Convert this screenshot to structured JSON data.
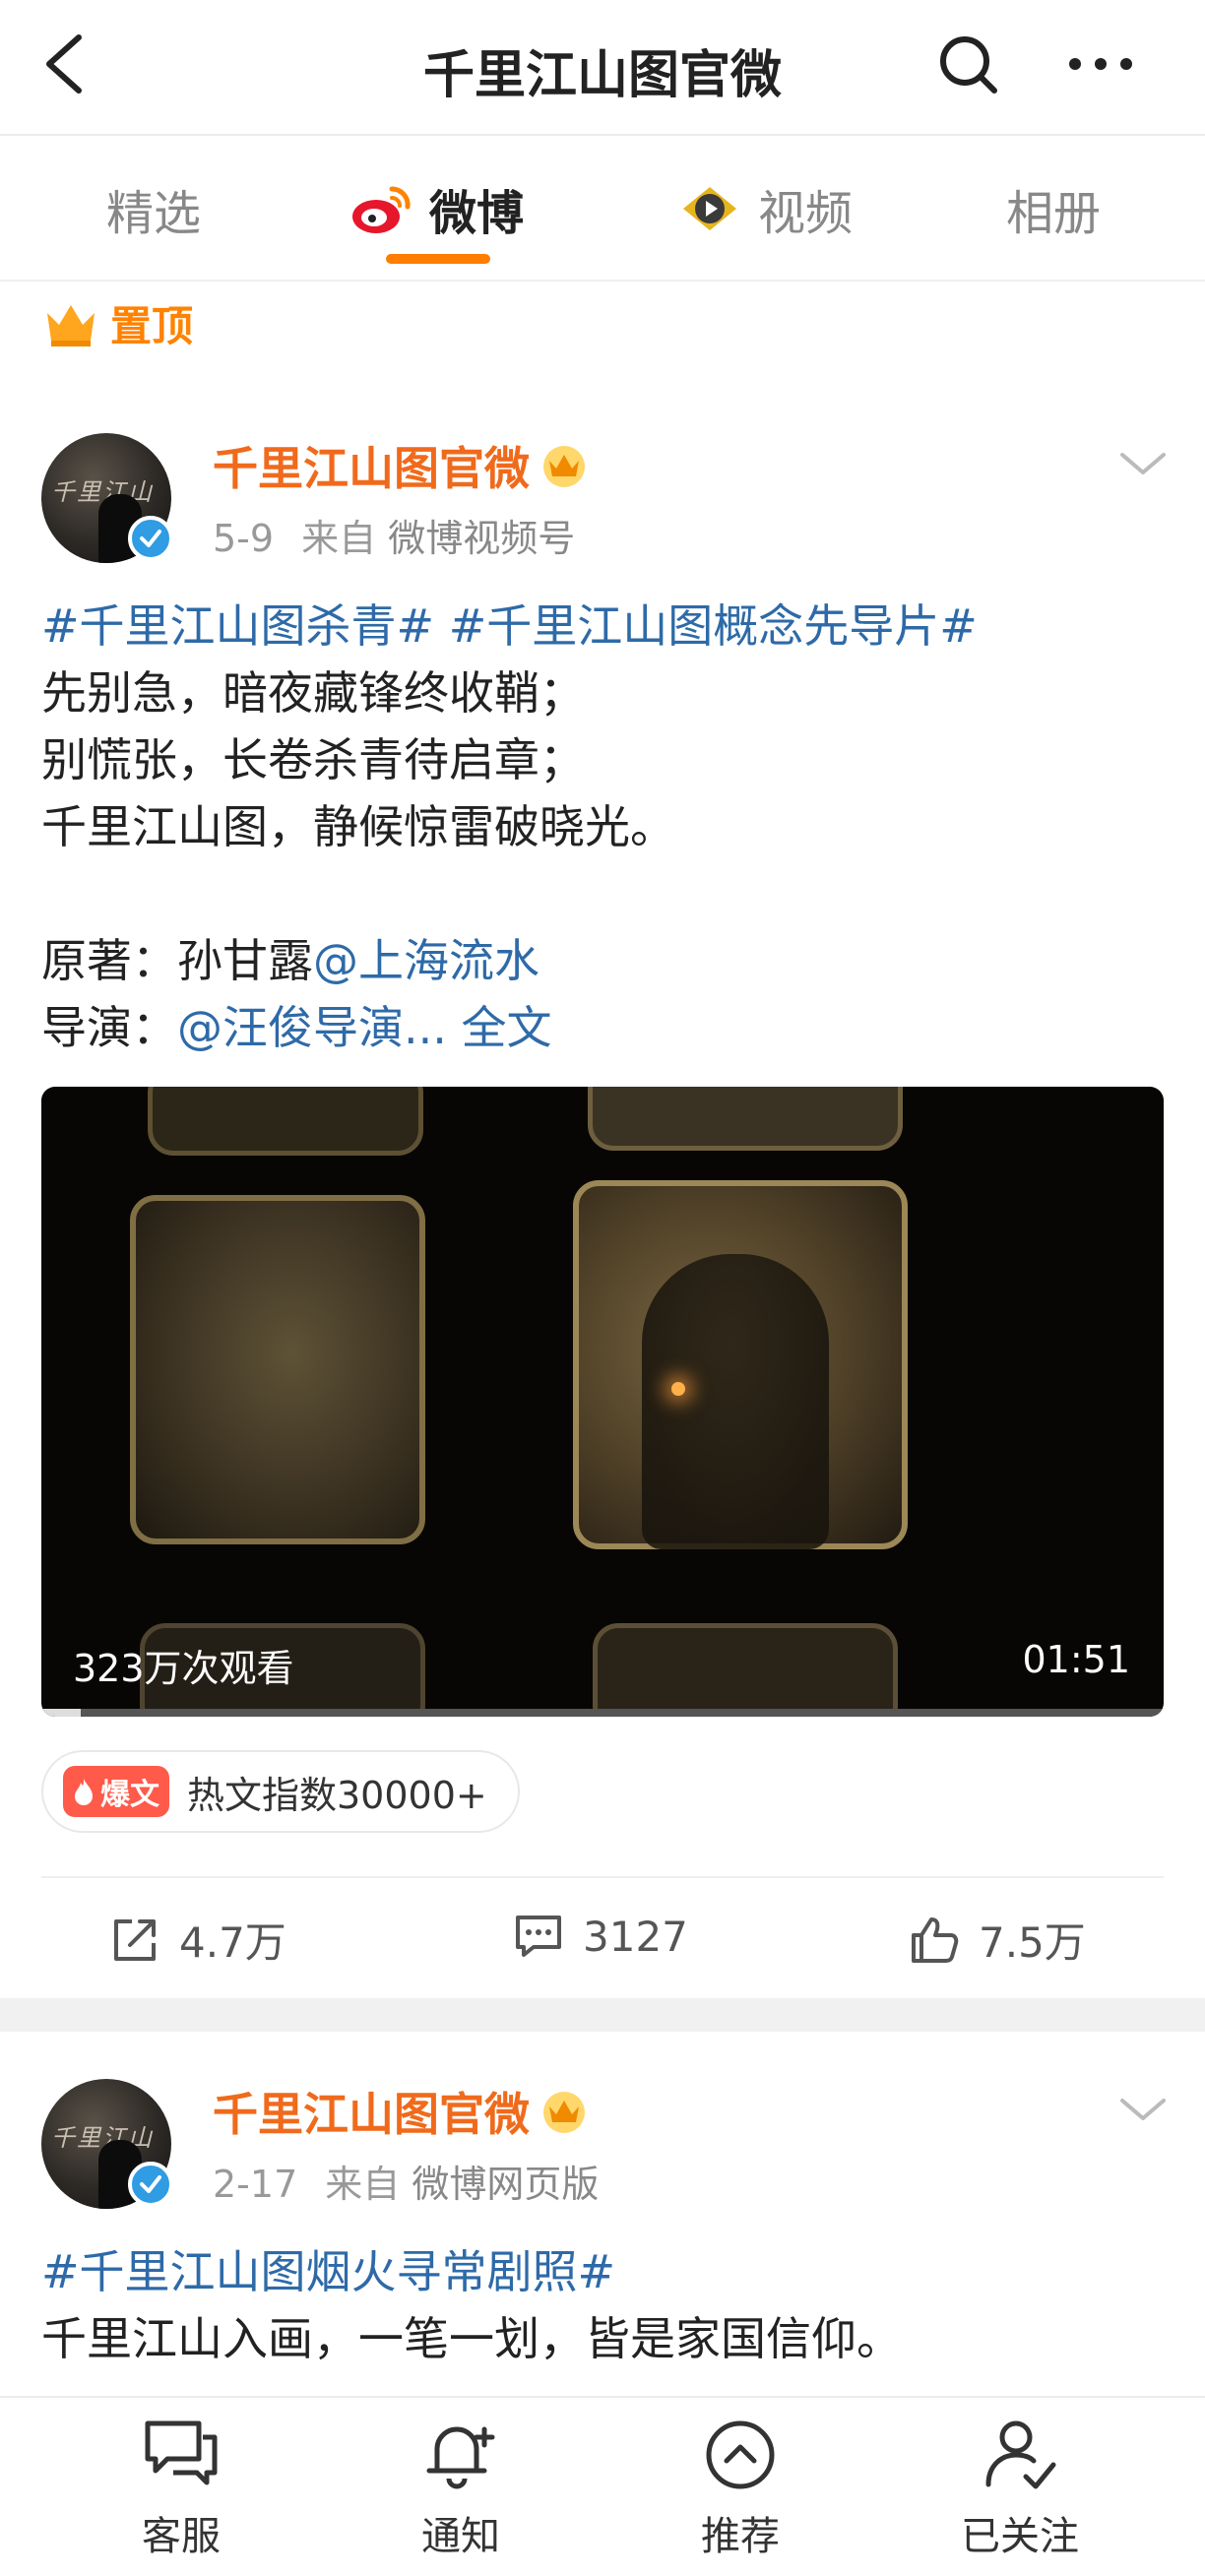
{
  "header": {
    "title": "千里江山图官微",
    "back_icon": "chevron-left-icon",
    "search_icon": "search-icon",
    "more_icon": "more-dots-icon"
  },
  "tabs": [
    {
      "label": "精选",
      "active": false
    },
    {
      "label": "微博",
      "active": true,
      "icon": "weibo-logo-icon"
    },
    {
      "label": "视频",
      "active": false,
      "icon": "video-tab-icon"
    },
    {
      "label": "相册",
      "active": false
    }
  ],
  "pinned": {
    "label": "置顶",
    "icon": "crown-icon"
  },
  "posts": [
    {
      "author": "千里江山图官微",
      "date": "5-9",
      "source_prefix": "来自",
      "source": "微博视频号",
      "hashtags": [
        "#千里江山图杀青#",
        "#千里江山图概念先导片#"
      ],
      "lines": [
        "先别急，暗夜藏锋终收鞘；",
        "别慌张，长卷杀青待启章；",
        "千里江山图，静候惊雷破晓光。"
      ],
      "credit1_label": "原著：孙甘露",
      "credit1_mention": "@上海流水",
      "credit2_label": "导演：",
      "credit2_mention": "@汪俊导演...",
      "full_text": "全文",
      "video": {
        "views": "323万次观看",
        "duration": "01:51",
        "progress": 0.035
      },
      "hot": {
        "tag": "爆文",
        "label": "热文指数30000+"
      },
      "reposts": "4.7万",
      "comments": "3127",
      "likes": "7.5万"
    },
    {
      "author": "千里江山图官微",
      "date": "2-17",
      "source_prefix": "来自",
      "source": "微博网页版",
      "hashtag": "#千里江山图烟火寻常剧照#",
      "line1": "千里江山入画，一笔一划，皆是家国信仰。"
    }
  ],
  "bottom_nav": [
    {
      "label": "客服",
      "icon": "chat-icon"
    },
    {
      "label": "通知",
      "icon": "bell-icon"
    },
    {
      "label": "推荐",
      "icon": "recommend-icon"
    },
    {
      "label": "已关注",
      "icon": "followed-user-icon"
    }
  ],
  "colors": {
    "accent": "#ff8200",
    "author": "#f06a1c",
    "link": "#2e6aa8",
    "verified": "#2f9ce3"
  }
}
